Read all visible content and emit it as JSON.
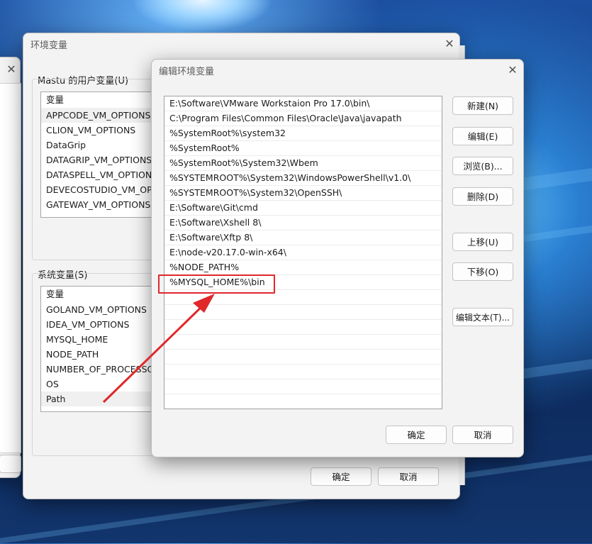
{
  "colors": {
    "accent_red": "#e0282b",
    "window_bg": "#f3f3f3"
  },
  "bg_window": {
    "user_list_first_cell": "",
    "button_partial": ""
  },
  "env_window": {
    "title": "环境变量",
    "user_group_label": "Mastu 的用户变量(U)",
    "user_table_header": "变量",
    "user_items": [
      "APPCODE_VM_OPTIONS",
      "CLION_VM_OPTIONS",
      "DataGrip",
      "DATAGRIP_VM_OPTIONS",
      "DATASPELL_VM_OPTIONS",
      "DEVECOSTUDIO_VM_OPTI",
      "GATEWAY_VM_OPTIONS"
    ],
    "system_group_label": "系统变量(S)",
    "system_table_header": "变量",
    "system_items": [
      "GOLAND_VM_OPTIONS",
      "IDEA_VM_OPTIONS",
      "MYSQL_HOME",
      "NODE_PATH",
      "NUMBER_OF_PROCESSOR",
      "OS",
      "Path"
    ],
    "ok_label": "确定",
    "cancel_label": "取消"
  },
  "edit_window": {
    "title": "编辑环境变量",
    "paths": [
      "E:\\Software\\VMware Workstaion Pro 17.0\\bin\\",
      "C:\\Program Files\\Common Files\\Oracle\\Java\\javapath",
      "%SystemRoot%\\system32",
      "%SystemRoot%",
      "%SystemRoot%\\System32\\Wbem",
      "%SYSTEMROOT%\\System32\\WindowsPowerShell\\v1.0\\",
      "%SYSTEMROOT%\\System32\\OpenSSH\\",
      "E:\\Software\\Git\\cmd",
      "E:\\Software\\Xshell 8\\",
      "E:\\Software\\Xftp 8\\",
      "E:\\node-v20.17.0-win-x64\\",
      "%NODE_PATH%",
      "%MYSQL_HOME%\\bin",
      "",
      "",
      "",
      "",
      "",
      "",
      "",
      ""
    ],
    "buttons": {
      "new": "新建(N)",
      "edit": "编辑(E)",
      "browse": "浏览(B)...",
      "delete": "删除(D)",
      "move_up": "上移(U)",
      "move_down": "下移(O)",
      "edit_text": "编辑文本(T)...",
      "ok": "确定",
      "cancel": "取消"
    }
  },
  "close_glyph": "✕"
}
